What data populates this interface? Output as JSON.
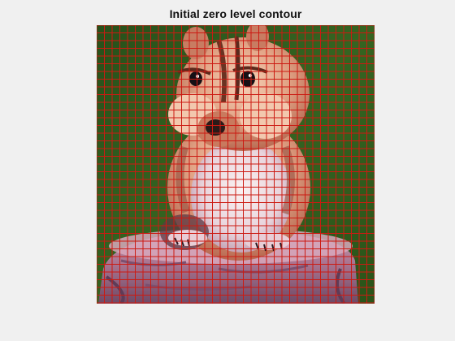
{
  "figure": {
    "title": "Initial zero level contour"
  },
  "image": {
    "subject-icon": "chipmunk-photo",
    "background_color": "#2f5a1b",
    "contour_color": "#cc1a12"
  }
}
